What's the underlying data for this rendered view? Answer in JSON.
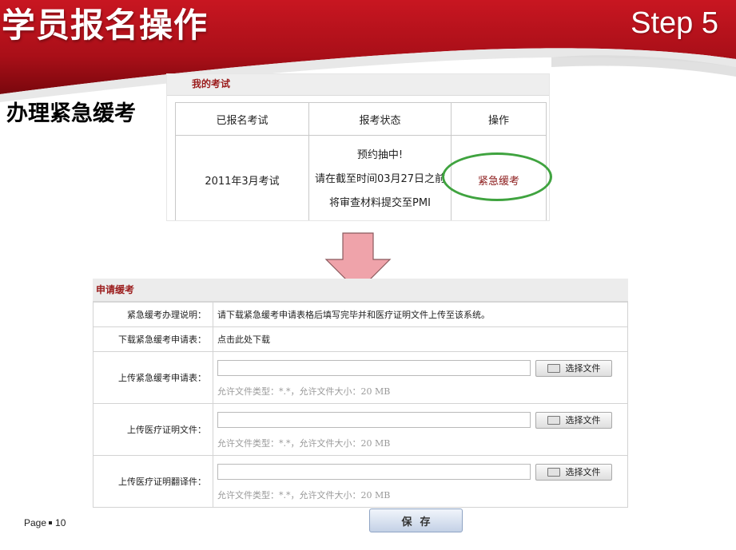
{
  "slide": {
    "title": "学员报名操作",
    "step": "Step 5",
    "subtitle": "办理紧急缓考",
    "page_label": "Page",
    "page_number": "10"
  },
  "colors": {
    "header_red": "#b3121b",
    "header_dark_red": "#7a070d",
    "panel_title": "#9b1c1c",
    "highlight_ring": "#3fa33f",
    "arrow_fill": "#efa3aa",
    "arrow_stroke": "#8a5a5e"
  },
  "my_exams": {
    "title": "我的考试",
    "columns": [
      "已报名考试",
      "报考状态",
      "操作"
    ],
    "rows": [
      {
        "exam": "2011年3月考试",
        "status_lines": [
          "预约抽中!",
          "请在截至时间03月27日之前",
          "将审查材料提交至PMI"
        ],
        "action": "紧急缓考"
      }
    ]
  },
  "apply_form": {
    "title": "申请缓考",
    "instructions_label": "紧急缓考办理说明：",
    "instructions_text": "请下载紧急缓考申请表格后填写完毕并和医疗证明文件上传至该系统。",
    "download_label": "下载紧急缓考申请表：",
    "download_link": "点击此处下载",
    "uploads": [
      {
        "label": "上传紧急缓考申请表：",
        "value": "",
        "button": "选择文件",
        "hint": "允许文件类型：*.*，允许文件大小：20 MB"
      },
      {
        "label": "上传医疗证明文件：",
        "value": "",
        "button": "选择文件",
        "hint": "允许文件类型：*.*，允许文件大小：20 MB"
      },
      {
        "label": "上传医疗证明翻译件：",
        "value": "",
        "button": "选择文件",
        "hint": "允许文件类型：*.*，允许文件大小：20 MB"
      }
    ],
    "save_button": "保存"
  }
}
